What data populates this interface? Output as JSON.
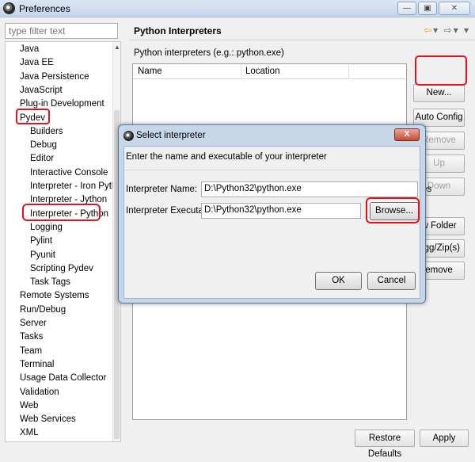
{
  "window": {
    "title": "Preferences",
    "controls": {
      "minimize": "—",
      "maximize": "▣",
      "close": "✕"
    }
  },
  "filter": {
    "placeholder": "type filter text"
  },
  "tree": {
    "items": [
      "Java",
      "Java EE",
      "Java Persistence",
      "JavaScript",
      "Plug-in Development",
      "Pydev",
      "Builders",
      "Debug",
      "Editor",
      "Interactive Console",
      "Interpreter - Iron Python",
      "Interpreter - Jython",
      "Interpreter - Python",
      "Logging",
      "Pylint",
      "Pyunit",
      "Scripting Pydev",
      "Task Tags",
      "Remote Systems",
      "Run/Debug",
      "Server",
      "Tasks",
      "Team",
      "Terminal",
      "Usage Data Collector",
      "Validation",
      "Web",
      "Web Services",
      "XML"
    ]
  },
  "page": {
    "title": "Python Interpreters",
    "subtitle": "Python interpreters (e.g.: python.exe)",
    "columns": [
      "Name",
      "Location"
    ],
    "buttons": {
      "new": "New...",
      "auto_config": "Auto Config",
      "remove": "Remove",
      "up": "Up",
      "down": "Down",
      "new_folder_partial": "w Folder",
      "egg_zip_partial": "Egg/Zip(s)",
      "remove_partial": "emove",
      "tab_partial": "es"
    },
    "restore_defaults": "Restore Defaults",
    "apply": "Apply"
  },
  "dialog": {
    "title": "Select interpreter",
    "message": "Enter the name and executable of your interpreter",
    "name_label": "Interpreter Name:",
    "name_value": "D:\\Python32\\python.exe",
    "exe_label": "Interpreter Executable:",
    "exe_value": "D:\\Python32\\python.exe",
    "browse": "Browse...",
    "ok": "OK",
    "cancel": "Cancel",
    "close": "X"
  },
  "colors": {
    "annotation": "#e0141e",
    "accent": "#e5a300"
  }
}
